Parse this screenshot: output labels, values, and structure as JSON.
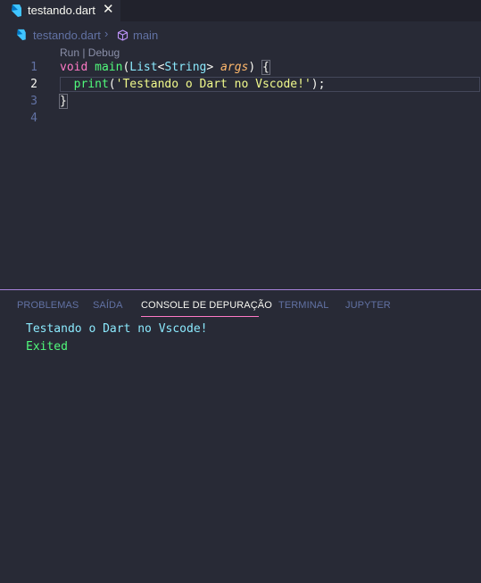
{
  "tab": {
    "filename": "testando.dart",
    "close_glyph": "✕",
    "icon": "dart-icon"
  },
  "breadcrumb": {
    "file": "testando.dart",
    "separator": "›",
    "symbol": "main",
    "symbol_icon": "method-cube-icon"
  },
  "codelens": {
    "text": "Run | Debug"
  },
  "editor": {
    "active_line": 2,
    "lines": [
      {
        "number": "1",
        "text": "void main(List<String> args) {"
      },
      {
        "number": "2",
        "text": "  print('Testando o Dart no Vscode!');"
      },
      {
        "number": "3",
        "text": "}"
      },
      {
        "number": "4",
        "text": ""
      }
    ],
    "tokens": {
      "void": "void",
      "main": "main",
      "list": "List",
      "lt": "<",
      "string": "String",
      "gt": ">",
      "args": "args",
      "print": "print",
      "literal": "'Testando o Dart no Vscode!'",
      "end": ");",
      "open_brace": "{",
      "close_brace": "}"
    }
  },
  "panel": {
    "tabs": [
      "PROBLEMAS",
      "SAÍDA",
      "CONSOLE DE DEPURAÇÃO",
      "TERMINAL",
      "JUPYTER"
    ],
    "active_tab": "CONSOLE DE DEPURAÇÃO",
    "console": {
      "output": "Testando o Dart no Vscode!",
      "exit": "Exited"
    }
  },
  "colors": {
    "background": "#282a36",
    "keyword": "#ff79c6",
    "function": "#50fa7b",
    "type": "#8be9fd",
    "parameter": "#ffb86c",
    "string": "#f1fa8c",
    "comment": "#6272a4",
    "accent": "#bd93f9"
  }
}
